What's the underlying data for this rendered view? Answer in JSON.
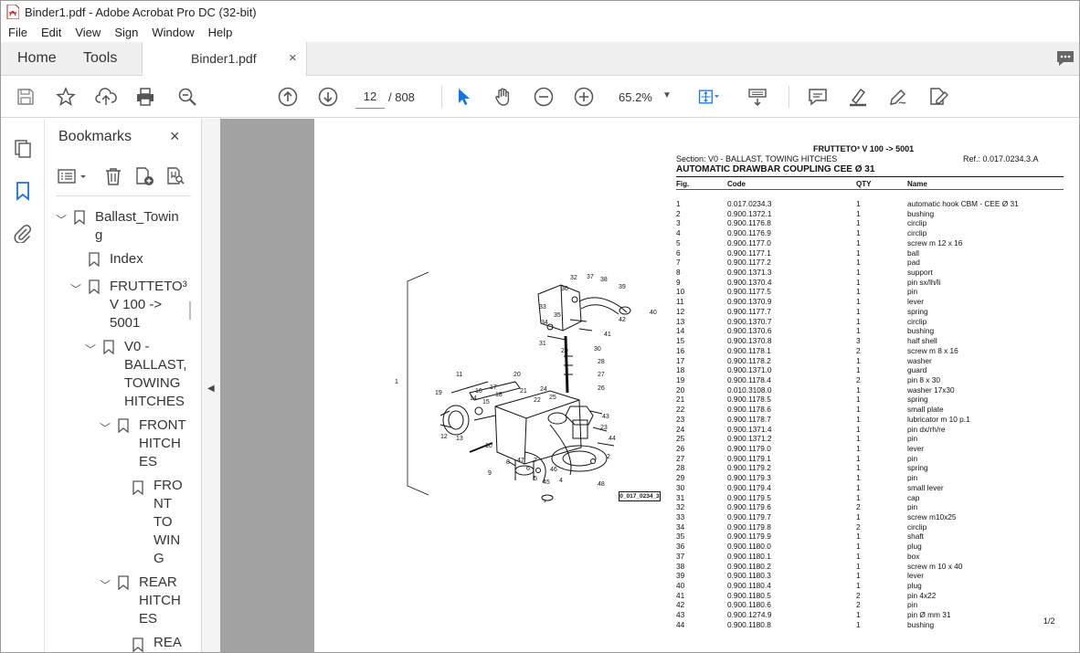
{
  "window": {
    "title": "Binder1.pdf - Adobe Acrobat Pro DC (32-bit)"
  },
  "menu": [
    "File",
    "Edit",
    "View",
    "Sign",
    "Window",
    "Help"
  ],
  "tabs": {
    "home": "Home",
    "tools": "Tools",
    "document": "Binder1.pdf",
    "close": "×"
  },
  "toolbar": {
    "page_current": "12",
    "page_total": "/ 808",
    "zoom": "65.2%"
  },
  "bookmarks": {
    "title": "Bookmarks",
    "close": "×",
    "tree": [
      {
        "label": "Ballast_Towin",
        "label2": "g"
      },
      {
        "label": "Index"
      },
      {
        "label": "FRUTTETO³",
        "label2": "V 100 ->",
        "label3": "5001"
      },
      {
        "label": "V0 -",
        "label2": "BALLAST,",
        "label3": "TOWING",
        "label4": "HITCHES"
      },
      {
        "label": "FRONT",
        "label2": "HITCH",
        "label3": "ES"
      },
      {
        "label": "FRO",
        "label2": "NT",
        "label3": "TO",
        "label4": "WIN",
        "label5": "G"
      },
      {
        "label": "REAR",
        "label2": "HITCH",
        "label3": "ES"
      },
      {
        "label": "REA"
      }
    ]
  },
  "document": {
    "title": "FRUTTETO³ V 100 -> 5001",
    "section": "Section: V0 - BALLAST, TOWING HITCHES",
    "ref": "Ref.: 0.017.0234.3.A",
    "heading": "AUTOMATIC DRAWBAR COUPLING CEE Ø 31",
    "columns": [
      "Fig.",
      "Code",
      "QTY",
      "Name"
    ],
    "drawing_ref": "0_017_0234_3",
    "page_indicator": "1/2",
    "parts": [
      [
        "1",
        "0.017.0234.3",
        "1",
        "automatic hook CBM - CEE Ø 31"
      ],
      [
        "2",
        "0.900.1372.1",
        "1",
        "bushing"
      ],
      [
        "3",
        "0.900.1176.8",
        "1",
        "circlip"
      ],
      [
        "4",
        "0.900.1176.9",
        "1",
        "circlip"
      ],
      [
        "5",
        "0.900.1177.0",
        "1",
        "screw m 12 x 16"
      ],
      [
        "6",
        "0.900.1177.1",
        "1",
        "ball"
      ],
      [
        "7",
        "0.900.1177.2",
        "1",
        "pad"
      ],
      [
        "8",
        "0.900.1371.3",
        "1",
        "support"
      ],
      [
        "9",
        "0.900.1370.4",
        "1",
        "pin sx/lh/li"
      ],
      [
        "10",
        "0.900.1177.5",
        "1",
        "pin"
      ],
      [
        "11",
        "0.900.1370.9",
        "1",
        "lever"
      ],
      [
        "12",
        "0.900.1177.7",
        "1",
        "spring"
      ],
      [
        "13",
        "0.900.1370.7",
        "1",
        "circlip"
      ],
      [
        "14",
        "0.900.1370.6",
        "1",
        "bushing"
      ],
      [
        "15",
        "0.900.1370.8",
        "3",
        "half shell"
      ],
      [
        "16",
        "0.900.1178.1",
        "2",
        "screw m 8 x 16"
      ],
      [
        "17",
        "0.900.1178.2",
        "1",
        "washer"
      ],
      [
        "18",
        "0.900.1371.0",
        "1",
        "guard"
      ],
      [
        "19",
        "0.900.1178.4",
        "2",
        "pin 8 x 30"
      ],
      [
        "20",
        "0.010.3108.0",
        "1",
        "washer 17x30"
      ],
      [
        "21",
        "0.900.1178.5",
        "1",
        "spring"
      ],
      [
        "22",
        "0.900.1178.6",
        "1",
        "small plate"
      ],
      [
        "23",
        "0.900.1178.7",
        "1",
        "lubricator m 10 p.1"
      ],
      [
        "24",
        "0.900.1371.4",
        "1",
        "pin dx/rh/re"
      ],
      [
        "25",
        "0.900.1371.2",
        "1",
        "pin"
      ],
      [
        "26",
        "0.900.1179.0",
        "1",
        "lever"
      ],
      [
        "27",
        "0.900.1179.1",
        "1",
        "pin"
      ],
      [
        "28",
        "0.900.1179.2",
        "1",
        "spring"
      ],
      [
        "29",
        "0.900.1179.3",
        "1",
        "pin"
      ],
      [
        "30",
        "0.900.1179.4",
        "1",
        "small lever"
      ],
      [
        "31",
        "0.900.1179.5",
        "1",
        "cap"
      ],
      [
        "32",
        "0.900.1179.6",
        "2",
        "pin"
      ],
      [
        "33",
        "0.900.1179.7",
        "1",
        "screw m10x25"
      ],
      [
        "34",
        "0.900.1179.8",
        "2",
        "circlip"
      ],
      [
        "35",
        "0.900.1179.9",
        "1",
        "shaft"
      ],
      [
        "36",
        "0.900.1180.0",
        "1",
        "plug"
      ],
      [
        "37",
        "0.900.1180.1",
        "1",
        "box"
      ],
      [
        "38",
        "0.900.1180.2",
        "1",
        "screw m 10 x 40"
      ],
      [
        "39",
        "0.900.1180.3",
        "1",
        "lever"
      ],
      [
        "40",
        "0.900.1180.4",
        "1",
        "plug"
      ],
      [
        "41",
        "0.900.1180.5",
        "2",
        "pin 4x22"
      ],
      [
        "42",
        "0.900.1180.6",
        "2",
        "pin"
      ],
      [
        "43",
        "0.900.1274.9",
        "1",
        "pin Ø mm 31"
      ],
      [
        "44",
        "0.900.1180.8",
        "1",
        "bushing"
      ]
    ],
    "callouts": [
      "1",
      "2",
      "3",
      "4",
      "5",
      "6",
      "7",
      "8",
      "9",
      "10",
      "11",
      "12",
      "13",
      "14",
      "15",
      "16",
      "17",
      "18",
      "19",
      "20",
      "21",
      "22",
      "23",
      "24",
      "25",
      "26",
      "27",
      "28",
      "29",
      "30",
      "31",
      "32",
      "33",
      "34",
      "35",
      "36",
      "37",
      "38",
      "39",
      "40",
      "41",
      "42",
      "43",
      "44",
      "45",
      "46",
      "47",
      "48"
    ]
  }
}
